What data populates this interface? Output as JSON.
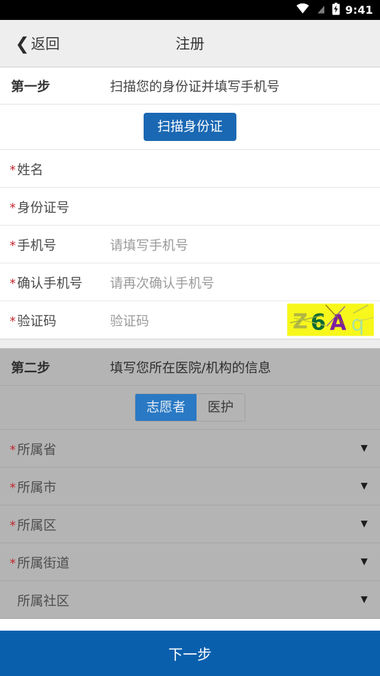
{
  "status_bar": {
    "time": "9:41",
    "icons": [
      "wifi-icon",
      "signal-off-icon",
      "battery-charging-icon"
    ]
  },
  "nav": {
    "back_label": "返回",
    "back_icon": "chevron-left-icon",
    "title": "注册"
  },
  "step_one": {
    "step_label": "第一步",
    "description": "扫描您的身份证并填写手机号",
    "scan_button": "扫描身份证",
    "fields": [
      {
        "required": true,
        "label": "姓名",
        "value": "",
        "placeholder": ""
      },
      {
        "required": true,
        "label": "身份证号",
        "value": "",
        "placeholder": ""
      },
      {
        "required": true,
        "label": "手机号",
        "value": "",
        "placeholder": "请填写手机号"
      },
      {
        "required": true,
        "label": "确认手机号",
        "value": "",
        "placeholder": "请再次确认手机号"
      },
      {
        "required": true,
        "label": "验证码",
        "value": "",
        "placeholder": "验证码"
      }
    ],
    "captcha": {
      "name": "captcha-image",
      "text": "Z6Aq",
      "characters": [
        "Z",
        "6",
        "A",
        "q"
      ],
      "background": "#f7f71c",
      "char_colors": [
        "#b2b743",
        "#0d6b33",
        "#7d1fa0",
        "#a8e2a0"
      ]
    }
  },
  "step_two": {
    "step_label": "第二步",
    "description": "填写您所在医院/机构的信息",
    "role_options": [
      {
        "label": "志愿者",
        "selected": true
      },
      {
        "label": "医护",
        "selected": false
      }
    ],
    "fields": [
      {
        "required": true,
        "label": "所属省",
        "value": "",
        "caret": "▼"
      },
      {
        "required": true,
        "label": "所属市",
        "value": "",
        "caret": "▼"
      },
      {
        "required": true,
        "label": "所属区",
        "value": "",
        "caret": "▼"
      },
      {
        "required": true,
        "label": "所属街道",
        "value": "",
        "caret": "▼"
      },
      {
        "required": false,
        "label": "所属社区",
        "value": "",
        "caret": "▼"
      }
    ]
  },
  "bottom": {
    "next_label": "下一步"
  },
  "colors": {
    "primary_blue": "#0a5fad",
    "button_blue": "#1a68b3",
    "segment_blue": "#2979c4",
    "required_red": "#c22b33",
    "disabled_grey": "#b4b4b4",
    "navbar_grey": "#eeeeee"
  }
}
